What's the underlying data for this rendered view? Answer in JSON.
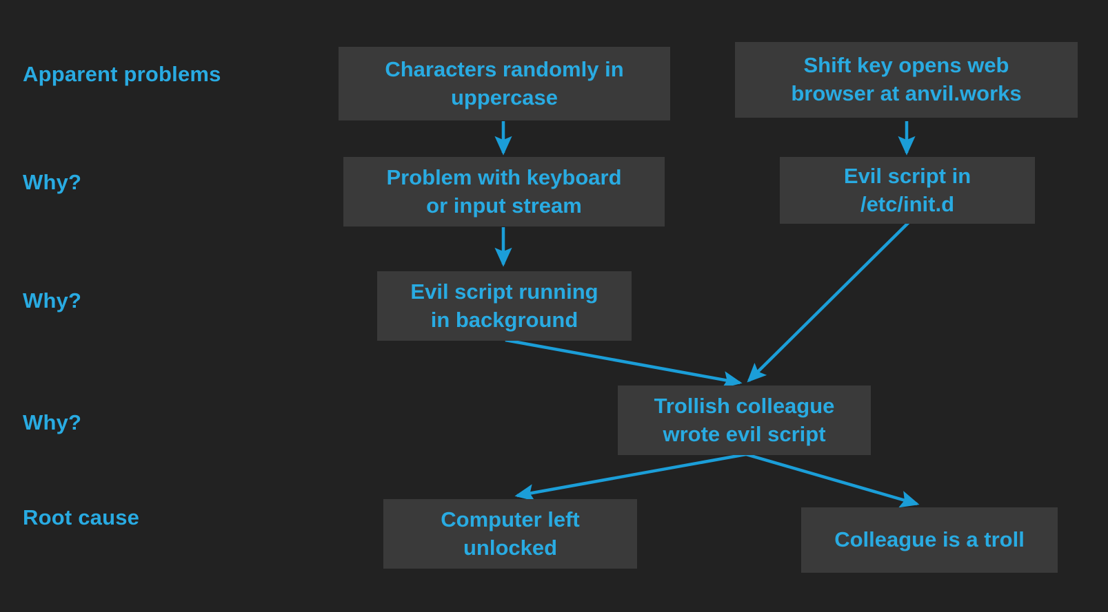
{
  "diagram": {
    "type": "five-whys-root-cause-analysis",
    "background_color": "#222222",
    "node_fill_color": "#3a3a3a",
    "accent_color": "#29ABE2",
    "stage_labels": [
      {
        "id": "apparent-problems",
        "text": "Apparent problems"
      },
      {
        "id": "why-1",
        "text": "Why?"
      },
      {
        "id": "why-2",
        "text": "Why?"
      },
      {
        "id": "why-3",
        "text": "Why?"
      },
      {
        "id": "root-cause",
        "text": "Root cause"
      }
    ],
    "nodes": [
      {
        "id": "characters-uppercase",
        "line1": "Characters randomly in",
        "line2": "uppercase"
      },
      {
        "id": "shift-key-browser",
        "line1": "Shift key opens web",
        "line2": "browser at anvil.works"
      },
      {
        "id": "keyboard-problem",
        "line1": "Problem with keyboard",
        "line2": "or input stream"
      },
      {
        "id": "evil-script-initd",
        "line1": "Evil script in",
        "line2": "/etc/init.d"
      },
      {
        "id": "evil-script-background",
        "line1": "Evil script running",
        "line2": "in background"
      },
      {
        "id": "trollish-colleague",
        "line1": "Trollish colleague",
        "line2": "wrote evil script"
      },
      {
        "id": "computer-unlocked",
        "line1": "Computer left",
        "line2": "unlocked"
      },
      {
        "id": "colleague-troll",
        "line1": "Colleague is a troll",
        "line2": ""
      }
    ],
    "edges": [
      {
        "from": "characters-uppercase",
        "to": "keyboard-problem"
      },
      {
        "from": "shift-key-browser",
        "to": "evil-script-initd"
      },
      {
        "from": "keyboard-problem",
        "to": "evil-script-background"
      },
      {
        "from": "evil-script-background",
        "to": "trollish-colleague"
      },
      {
        "from": "evil-script-initd",
        "to": "trollish-colleague"
      },
      {
        "from": "trollish-colleague",
        "to": "computer-unlocked"
      },
      {
        "from": "trollish-colleague",
        "to": "colleague-troll"
      }
    ]
  }
}
